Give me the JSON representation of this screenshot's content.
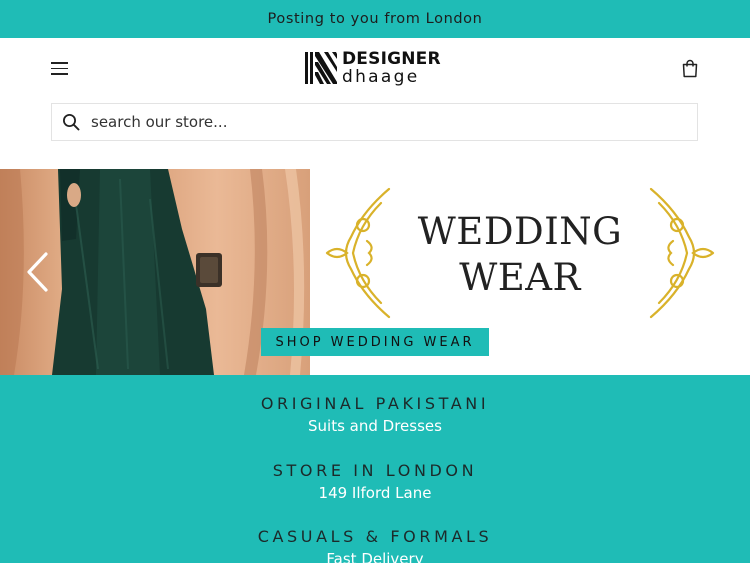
{
  "announcement": "Posting to you from London",
  "header": {
    "logo_top": "DESIGNER",
    "logo_bottom": "dhaage"
  },
  "search": {
    "placeholder": "search our store..."
  },
  "hero": {
    "headline_line1": "WEDDING",
    "headline_line2": "WEAR",
    "cta_label": "SHOP WEDDING WEAR"
  },
  "features": [
    {
      "title": "ORIGINAL PAKISTANI",
      "subtitle": "Suits and Dresses"
    },
    {
      "title": "STORE IN LONDON",
      "subtitle": "149 Ilford Lane"
    },
    {
      "title": "CASUALS & FORMALS",
      "subtitle": "Fast Delivery"
    }
  ],
  "colors": {
    "brand_teal": "#1fbcb6",
    "ornament_gold": "#d9b22a"
  },
  "icons": [
    "menu-icon",
    "cart-icon",
    "search-icon",
    "chevron-left-icon"
  ]
}
